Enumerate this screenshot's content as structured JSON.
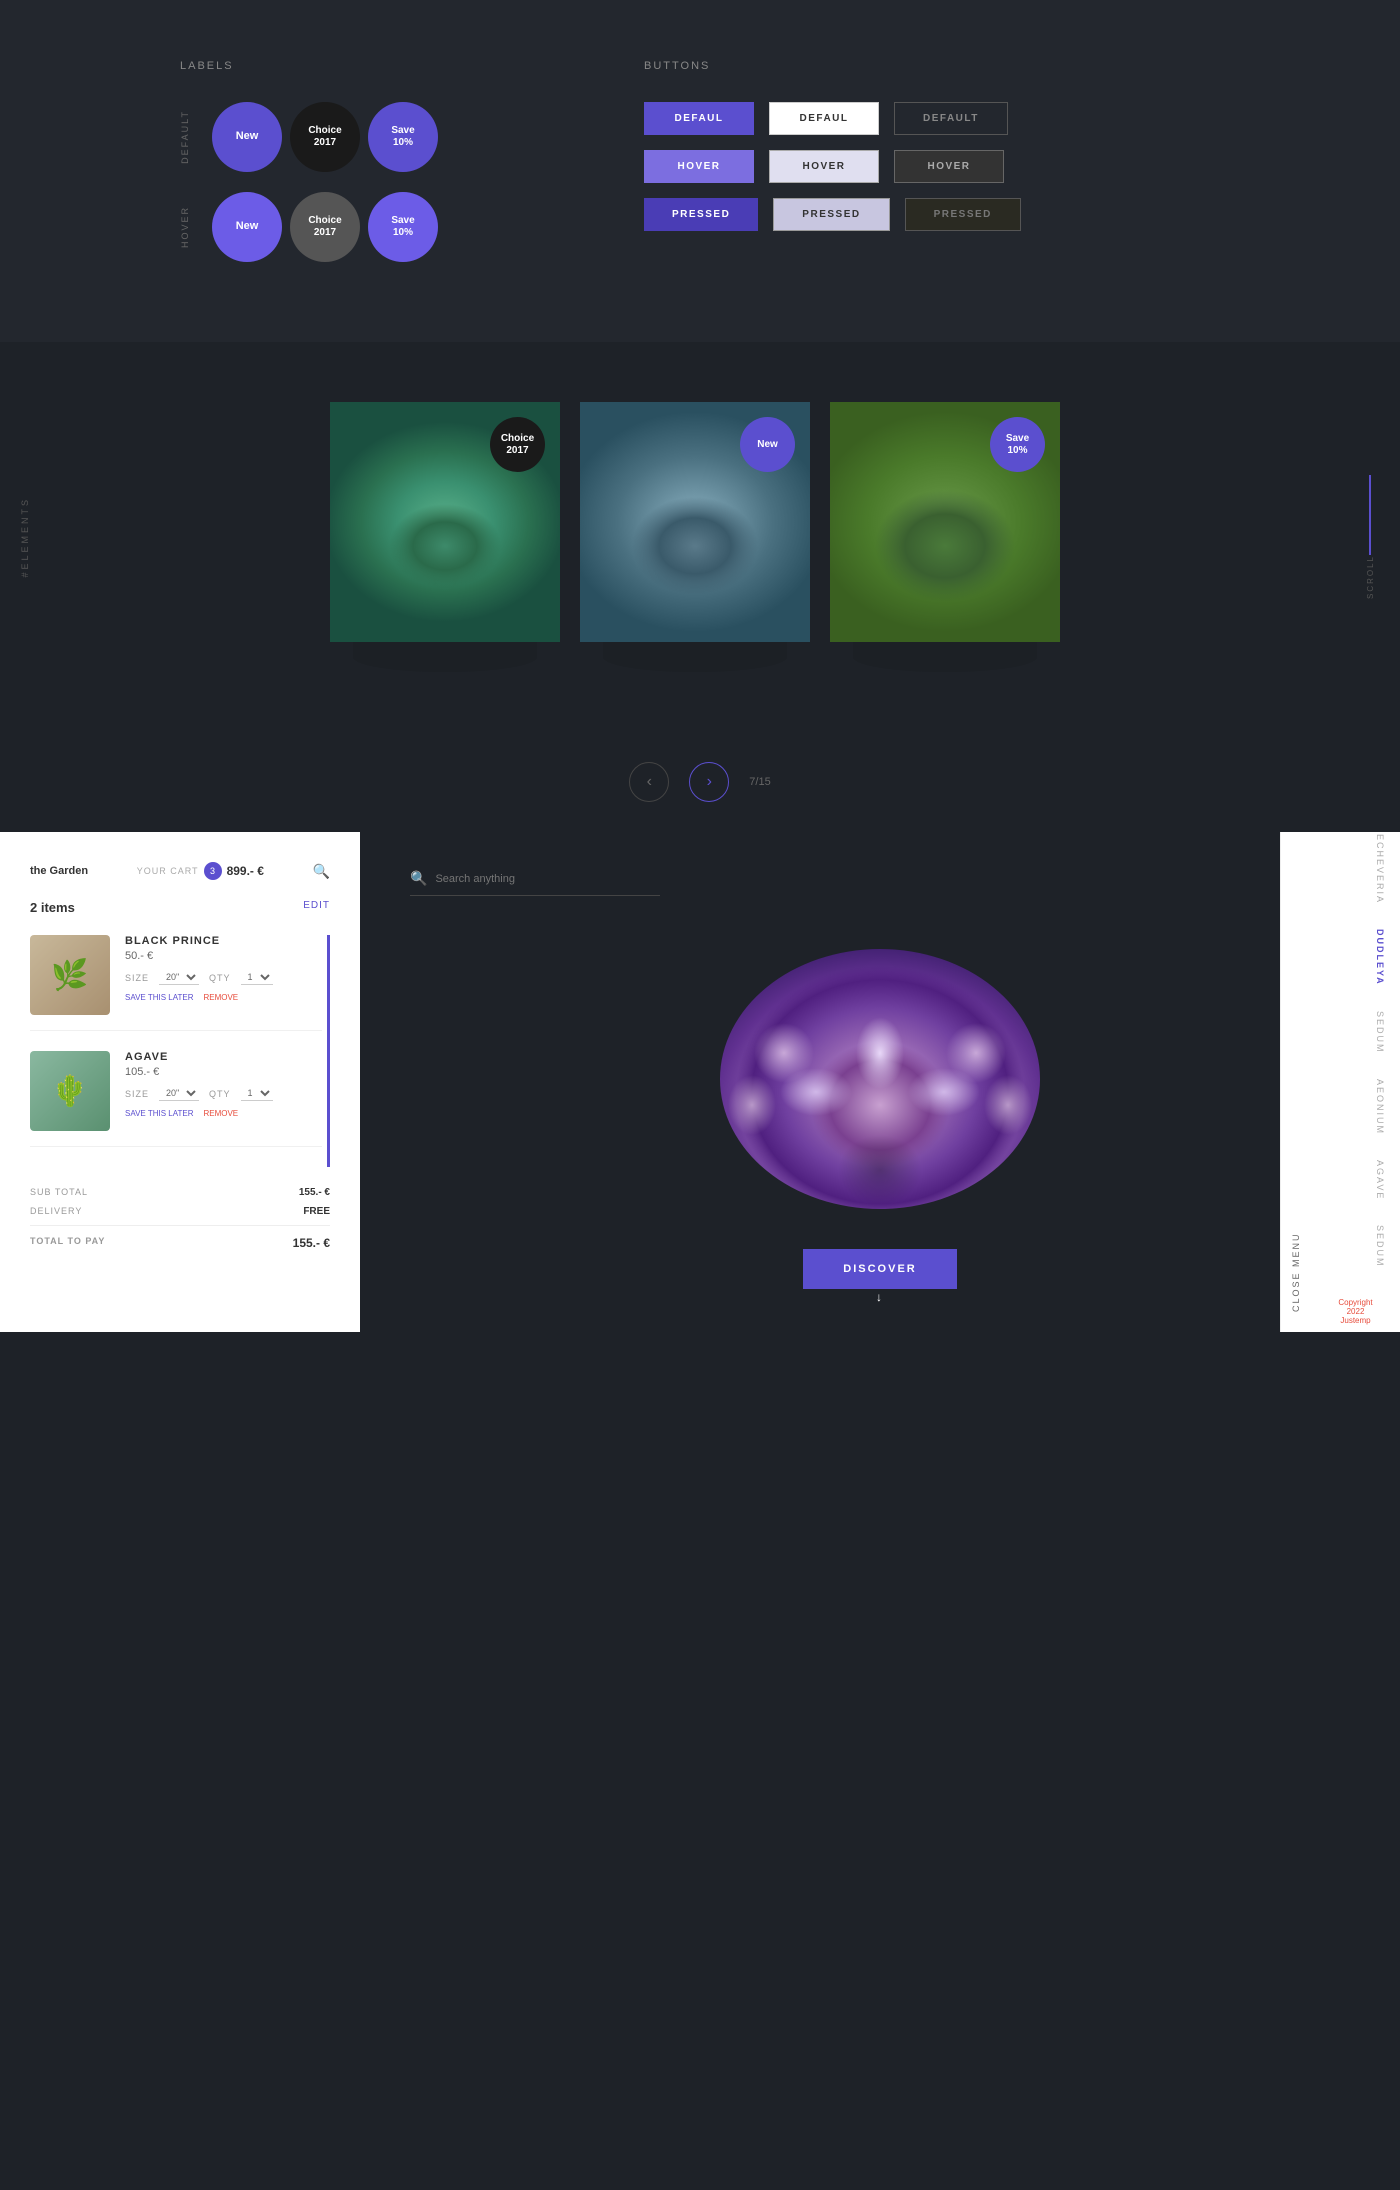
{
  "top": {
    "labels_title": "LABELS",
    "buttons_title": "BUTTONS",
    "label_rows": [
      {
        "row_type": "DEFAULT",
        "badges": [
          {
            "text": "New",
            "color": "purple"
          },
          {
            "text": "Choice 2017",
            "color": "dark"
          },
          {
            "text": "Save 10%",
            "color": "purple"
          }
        ]
      },
      {
        "row_type": "HOVER",
        "badges": [
          {
            "text": "New",
            "color": "purple-light"
          },
          {
            "text": "Choice 2017",
            "color": "gray"
          },
          {
            "text": "Save 10%",
            "color": "purple-light"
          }
        ]
      }
    ],
    "button_rows": [
      {
        "state": "DEFAULT",
        "buttons": [
          {
            "label": "DEFAUL",
            "style": "purple-default"
          },
          {
            "label": "DEFAUL",
            "style": "white-default"
          },
          {
            "label": "DEFAULT",
            "style": "dark-default"
          }
        ]
      },
      {
        "state": "HOVER",
        "buttons": [
          {
            "label": "HOVER",
            "style": "purple-hover"
          },
          {
            "label": "HOVER",
            "style": "white-hover"
          },
          {
            "label": "HOVER",
            "style": "dark-hover"
          }
        ]
      },
      {
        "state": "PRESSED",
        "buttons": [
          {
            "label": "PRESSED",
            "style": "purple-pressed"
          },
          {
            "label": "PRESSED",
            "style": "white-pressed"
          },
          {
            "label": "PRESSED",
            "style": "dark-pressed"
          }
        ]
      }
    ]
  },
  "elements": {
    "section_label": "#ELEMENTS",
    "cards": [
      {
        "badge": "Choice 2017",
        "badge_color": "dark",
        "image_type": "succulent-1"
      },
      {
        "badge": "New",
        "badge_color": "purple",
        "image_type": "succulent-2"
      },
      {
        "badge": "Save 10%",
        "badge_color": "purple",
        "image_type": "succulent-3"
      }
    ],
    "pagination": {
      "prev": "<",
      "next": ">",
      "current": "7/15",
      "scroll_label": "SCROLL"
    }
  },
  "cart": {
    "brand": "the Garden",
    "your_cart_label": "YOUR CART",
    "cart_count": "3",
    "cart_price": "899.- €",
    "items_count": "2 items",
    "edit_label": "EDIT",
    "items": [
      {
        "name": "BLACK PRINCE",
        "price": "50.- €",
        "size_label": "SIZE",
        "size_value": "20\"",
        "qty_label": "QTY",
        "qty_value": "1",
        "save_label": "SAVE THIS LATER",
        "delete_label": "REMOVE"
      },
      {
        "name": "AGAVE",
        "price": "105.- €",
        "size_label": "SIZE",
        "size_value": "20\"",
        "qty_label": "QTY",
        "qty_value": "1",
        "save_label": "SAVE THIS LATER",
        "delete_label": "REMOVE"
      }
    ],
    "summary": {
      "sub_total_label": "SUB TOTAL",
      "sub_total_value": "155.- €",
      "delivery_label": "DELIVERY",
      "delivery_value": "FREE",
      "total_label": "TOTAL TO PAY",
      "total_value": "155.- €"
    }
  },
  "search": {
    "placeholder": "Search anything"
  },
  "discover_btn": "DISCOVER",
  "side_menu": {
    "close_label": "CLOSE MENU",
    "items": [
      {
        "label": "ECHEVERIA",
        "active": true
      },
      {
        "label": "DUDLEYA",
        "active": false
      },
      {
        "label": "SEDUM",
        "active": false
      },
      {
        "label": "AEONIUM",
        "active": false
      },
      {
        "label": "AGAVE",
        "active": false
      },
      {
        "label": "SEDUM",
        "active": false
      }
    ],
    "copyright": "Copyright 2022 Justemp"
  },
  "your_label": "YoUR"
}
